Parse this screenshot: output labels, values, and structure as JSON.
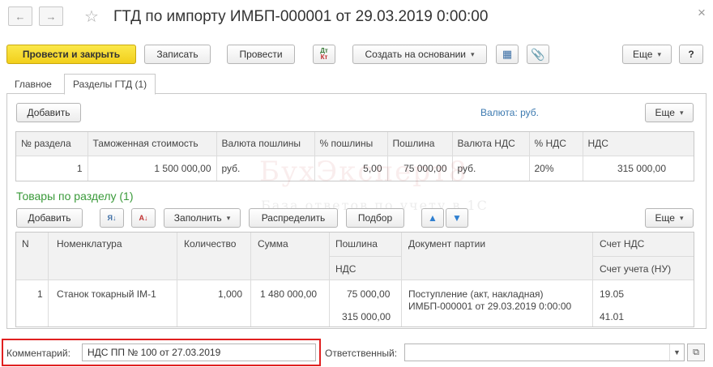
{
  "header": {
    "title": "ГТД по импорту ИМБП-000001 от 29.03.2019 0:00:00",
    "close": "×"
  },
  "toolbar": {
    "post_close": "Провести и закрыть",
    "save": "Записать",
    "post": "Провести",
    "create_basis": "Создать на основании",
    "more": "Еще",
    "help": "?"
  },
  "tabs": [
    {
      "label": "Главное"
    },
    {
      "label": "Разделы ГТД (1)"
    }
  ],
  "sections": {
    "add": "Добавить",
    "currency": "Валюта: руб.",
    "more": "Еще",
    "columns": [
      "№ раздела",
      "Таможенная стоимость",
      "Валюта пошлины",
      "% пошлины",
      "Пошлина",
      "Валюта НДС",
      "% НДС",
      "НДС"
    ],
    "rows": [
      [
        "1",
        "1 500 000,00",
        "руб.",
        "5,00",
        "75 000,00",
        "руб.",
        "20%",
        "315 000,00"
      ]
    ]
  },
  "goods": {
    "title": "Товары по разделу (1)",
    "add": "Добавить",
    "fill": "Заполнить",
    "distribute": "Распределить",
    "select": "Подбор",
    "more": "Еще",
    "columns": {
      "n": "N",
      "nom": "Номенклатура",
      "qty": "Количество",
      "sum": "Сумма",
      "duty": "Пошлина",
      "vat": "НДС",
      "doc": "Документ партии",
      "vat_acc": "Счет НДС",
      "acc_nu": "Счет учета (НУ)"
    },
    "rows": [
      {
        "n": "1",
        "nom": "Станок токарный IM-1",
        "qty": "1,000",
        "sum": "1 480 000,00",
        "duty": "75 000,00",
        "vat": "315 000,00",
        "doc1": "Поступление (акт, накладная)",
        "doc2": "ИМБП-000001 от 29.03.2019 0:00:00",
        "vat_acc": "19.05",
        "acc_nu": "41.01"
      }
    ]
  },
  "footer": {
    "comment_label": "Комментарий:",
    "comment_value": "НДС ПП № 100 от 27.03.2019",
    "responsible_label": "Ответственный:",
    "responsible_value": ""
  },
  "watermark": {
    "line1": "БухЭксперт8",
    "line2": "База ответов по учету в 1С"
  },
  "colors": {
    "primary_button": "#f5d526",
    "highlight_border": "#e02020",
    "section_title": "#3a9a3a"
  }
}
